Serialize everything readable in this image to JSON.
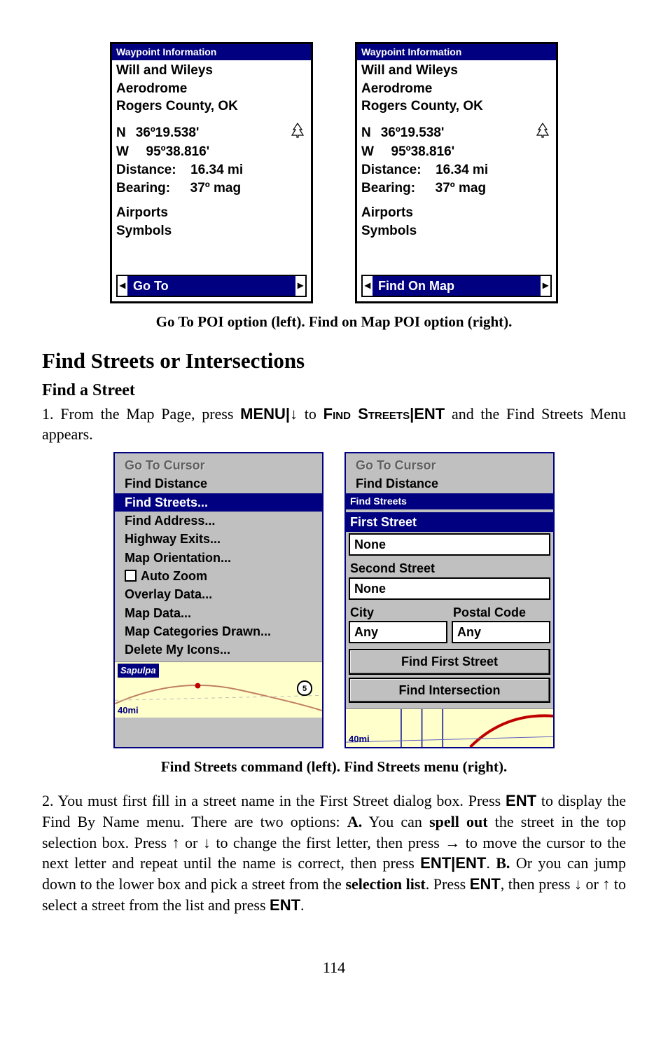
{
  "waypoint_left": {
    "titlebar": "Waypoint Information",
    "name": "Will and Wileys",
    "type": "Aerodrome",
    "location": "Rogers County, OK",
    "lat_prefix": "N",
    "lat": "36º19.538'",
    "lon_prefix": "W",
    "lon": "95º38.816'",
    "distance_label": "Distance:",
    "distance_val": "16.34 mi",
    "bearing_label": "Bearing:",
    "bearing_val": "37º mag",
    "cat1": "Airports",
    "cat2": "Symbols",
    "selector": "Go To"
  },
  "waypoint_right": {
    "titlebar": "Waypoint Information",
    "name": "Will and Wileys",
    "type": "Aerodrome",
    "location": "Rogers County, OK",
    "lat_prefix": "N",
    "lat": "36º19.538'",
    "lon_prefix": "W",
    "lon": "95º38.816'",
    "distance_label": "Distance:",
    "distance_val": "16.34 mi",
    "bearing_label": "Bearing:",
    "bearing_val": "37º mag",
    "cat1": "Airports",
    "cat2": "Symbols",
    "selector": "Find On Map"
  },
  "caption1": "Go To POI option (left).  Find on Map POI option (right).",
  "section_title": "Find Streets or Intersections",
  "subsection_title": "Find a Street",
  "para1_prefix": "1. From the Map Page, press ",
  "para1_menu": "MENU",
  "para1_pipe1": "|",
  "para1_to": " to ",
  "para1_find": "Find Streets",
  "para1_pipe2": "|",
  "para1_ent": "ENT",
  "para1_suffix": " and the Find Streets Menu appears.",
  "menu_left": {
    "items": [
      {
        "label": "Go To Cursor",
        "state": "disabled"
      },
      {
        "label": "Find Distance",
        "state": "normal"
      },
      {
        "label": "Find Streets...",
        "state": "selected"
      },
      {
        "label": "Find Address...",
        "state": "normal"
      },
      {
        "label": "Highway Exits...",
        "state": "normal"
      },
      {
        "label": "Map Orientation...",
        "state": "normal"
      },
      {
        "label": "Auto Zoom",
        "state": "checkbox"
      },
      {
        "label": "Overlay Data...",
        "state": "normal"
      },
      {
        "label": "Map Data...",
        "state": "normal"
      },
      {
        "label": "Map Categories Drawn...",
        "state": "normal"
      },
      {
        "label": "Delete My Icons...",
        "state": "normal"
      }
    ],
    "town": "Sapulpa",
    "scale": "40mi",
    "hwy": "5"
  },
  "menu_right": {
    "top_items": [
      {
        "label": "Go To Cursor",
        "state": "disabled"
      },
      {
        "label": "Find Distance",
        "state": "normal"
      }
    ],
    "form_title": "Find Streets",
    "first_street_label": "First Street",
    "first_street_val": "None",
    "second_street_label": "Second Street",
    "second_street_val": "None",
    "city_label": "City",
    "postal_label": "Postal Code",
    "city_val": "Any",
    "postal_val": "Any",
    "btn1": "Find First Street",
    "btn2": "Find Intersection",
    "scale": "40mi"
  },
  "caption2": "Find Streets command (left). Find Streets menu (right).",
  "para2": {
    "t1": "2. You must first fill in a street name in the First Street dialog box. Press ",
    "ent1": "ENT",
    "t2": " to display the Find By Name menu. There are two options: ",
    "a": "A.",
    "t3": " You can ",
    "spell": "spell out",
    "t4": " the street in the top selection box. Press ",
    "t5": " or ",
    "t6": " to change the first letter, then press ",
    "t7": " to move the cursor to the next letter and repeat until the name is correct, then press ",
    "entent": "ENT",
    "pipe": "|",
    "ent2": "ENT",
    "t8": ". ",
    "b": "B.",
    "t9": " Or you can jump down to the lower box and pick a street from the ",
    "sel": "selection list",
    "t10": ". Press ",
    "ent3": "ENT",
    "t11": ", then press ",
    "t12": " or ",
    "t13": " to select a street from the list and press ",
    "ent4": "ENT",
    "t14": "."
  },
  "page_number": "114"
}
